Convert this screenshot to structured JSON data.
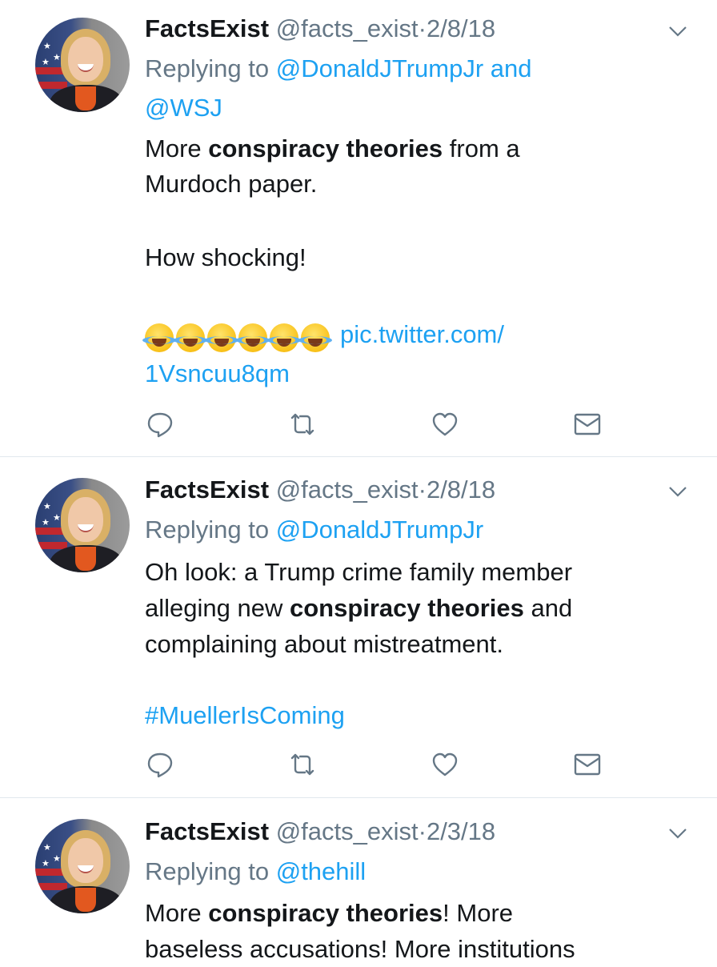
{
  "tweets": [
    {
      "name": "FactsExist",
      "handle": "@facts_exist",
      "sep": "·",
      "date": "2/8/18",
      "replying_prefix": "Replying to",
      "replying_line1": "@DonaldJTrumpJr and",
      "replying_line2": "@WSJ",
      "body": {
        "l1_pre": "More ",
        "l1_bold": "conspiracy theories",
        "l1_post": " from a",
        "l2": "Murdoch paper.",
        "l3": "How shocking!",
        "emoji_icons": [
          "face-with-tears-of-joy-icon",
          "face-with-tears-of-joy-icon",
          "face-with-tears-of-joy-icon",
          "face-with-tears-of-joy-icon",
          "face-with-tears-of-joy-icon",
          "face-with-tears-of-joy-icon"
        ],
        "link1": "pic.twitter.com/",
        "link2": "1Vsncuu8qm"
      }
    },
    {
      "name": "FactsExist",
      "handle": "@facts_exist",
      "sep": "·",
      "date": "2/8/18",
      "replying_prefix": "Replying to",
      "replying_line1": "@DonaldJTrumpJr",
      "body": {
        "l1": "Oh look: a Trump crime family member",
        "l2_pre": "alleging new ",
        "l2_bold": "conspiracy theories",
        "l2_post": " and",
        "l3": "complaining about mistreatment.",
        "hashtag": "#MuellerIsComing"
      }
    },
    {
      "name": "FactsExist",
      "handle": "@facts_exist",
      "sep": "·",
      "date": "2/3/18",
      "replying_prefix": "Replying to",
      "replying_line1": "@thehill",
      "body": {
        "l1_pre": "More ",
        "l1_bold": "conspiracy theories",
        "l1_post": "! More",
        "l2": "baseless accusations! More institutions"
      }
    }
  ],
  "colors": {
    "link": "#1da1f2",
    "meta": "#657786",
    "text": "#14171a",
    "divider": "#e1e8ed",
    "icon": "#657786"
  }
}
